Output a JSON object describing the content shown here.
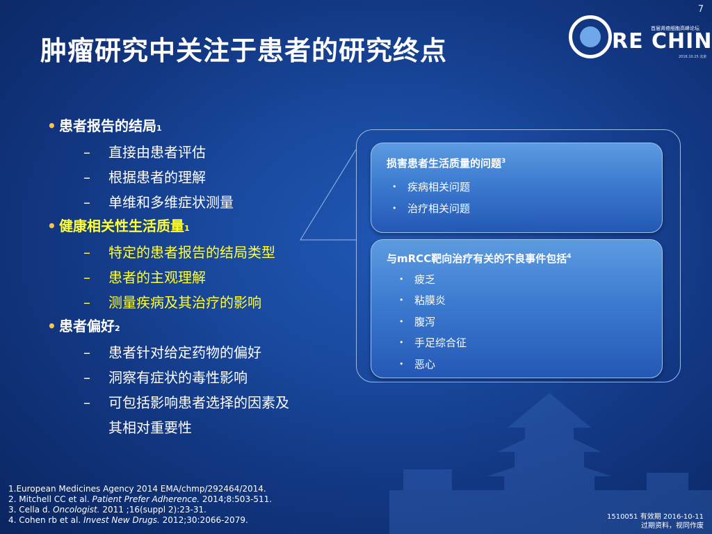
{
  "slide": {
    "number": "7",
    "title": "肿瘤研究中关注于患者的研究终点"
  },
  "logo": {
    "word": "RE CHINA",
    "cn_subtitle": "首届肾癌细胞高峰论坛",
    "date": "2016.10.25 北京"
  },
  "bullets": [
    {
      "text": "患者报告的结局",
      "sup": "1",
      "highlight": false,
      "subs": [
        "直接由患者评估",
        "根据患者的理解",
        "单维和多维症状测量"
      ]
    },
    {
      "text": "健康相关性生活质量",
      "sup": "1",
      "highlight": true,
      "subs": [
        "特定的患者报告的结局类型",
        "患者的主观理解",
        "测量疾病及其治疗的影响"
      ]
    },
    {
      "text": "患者偏好",
      "sup": "2",
      "highlight": false,
      "subs": [
        "患者针对给定药物的偏好",
        "洞察有症状的毒性影响",
        "可包括影响患者选择的因素及",
        "其相对重要性"
      ]
    }
  ],
  "box1": {
    "heading": "损害患者生活质量的问题",
    "sup": "3",
    "items": [
      "疾病相关问题",
      "治疗相关问题"
    ]
  },
  "box2": {
    "heading": "与mRCC靶向治疗有关的不良事件包括",
    "sup": "4",
    "items": [
      "疲乏",
      "粘膜炎",
      "腹泻",
      "手足综合征",
      "恶心"
    ]
  },
  "footnotes": {
    "ref1": "1.European Medicines Agency 2014 EMA/chmp/292464/2014.",
    "ref2_pre": "2. Mitchell CC et al. ",
    "ref2_journal": "Patient Prefer Adherence.",
    "ref2_post": " 2014;8:503-511.",
    "ref3_pre": "3. Cella d. ",
    "ref3_journal": "Oncologist.",
    "ref3_post": " 2011 ;16(suppl 2):23-31.",
    "ref4_pre": "4. Cohen rb et al. ",
    "ref4_journal": "Invest New Drugs.",
    "ref4_post": " 2012;30:2066-2079."
  },
  "meta": {
    "line1": "1510051  有效期 2016-10-11",
    "line2": "过期资料，视同作废"
  },
  "colors": {
    "background": "#1a4aa0",
    "highlight_text": "#ffff33",
    "bullet_dot": "#ffc04a",
    "box_fill": "#3c7bd0"
  }
}
